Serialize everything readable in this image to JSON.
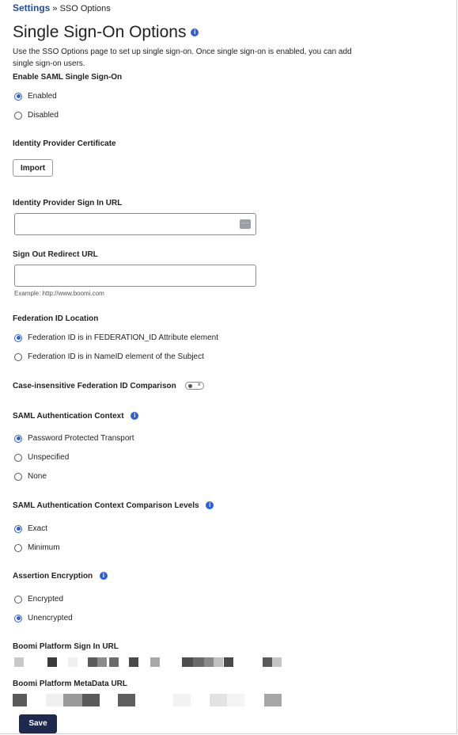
{
  "breadcrumb": {
    "root": "Settings",
    "separator": "»",
    "current": "SSO Options"
  },
  "page": {
    "title": "Single Sign-On Options",
    "description": "Use the SSO Options page to set up single sign-on. Once single sign-on is enabled, you can add single sign-on users."
  },
  "saml_enable": {
    "label": "Enable SAML Single Sign-On",
    "options": [
      "Enabled",
      "Disabled"
    ],
    "selected": "Enabled"
  },
  "idp_certificate": {
    "label": "Identity Provider Certificate",
    "import_label": "Import"
  },
  "idp_signin_url": {
    "label": "Identity Provider Sign In URL",
    "value": ""
  },
  "signout_redirect": {
    "label": "Sign Out Redirect URL",
    "value": "",
    "hint": "Example: http://www.boomi.com"
  },
  "federation_id_location": {
    "label": "Federation ID Location",
    "options": [
      "Federation ID is in FEDERATION_ID Attribute element",
      "Federation ID is in NameID element of the Subject"
    ],
    "selected": "Federation ID is in FEDERATION_ID Attribute element"
  },
  "case_insensitive": {
    "label": "Case-insensitive Federation ID Comparison",
    "enabled": false
  },
  "auth_context": {
    "label": "SAML Authentication Context",
    "options": [
      "Password Protected Transport",
      "Unspecified",
      "None"
    ],
    "selected": "Password Protected Transport"
  },
  "comparison_levels": {
    "label": "SAML Authentication Context Comparison Levels",
    "options": [
      "Exact",
      "Minimum"
    ],
    "selected": "Exact"
  },
  "assertion_encryption": {
    "label": "Assertion Encryption",
    "options": [
      "Encrypted",
      "Unencrypted"
    ],
    "selected": "Unencrypted"
  },
  "platform_signin_url": {
    "label": "Boomi Platform Sign In URL"
  },
  "platform_metadata_url": {
    "label": "Boomi Platform MetaData URL"
  },
  "actions": {
    "save_label": "Save"
  },
  "colors": {
    "accent": "#2f5fd8",
    "link": "#1f4d9b",
    "save_bg": "#1d2a4d"
  }
}
